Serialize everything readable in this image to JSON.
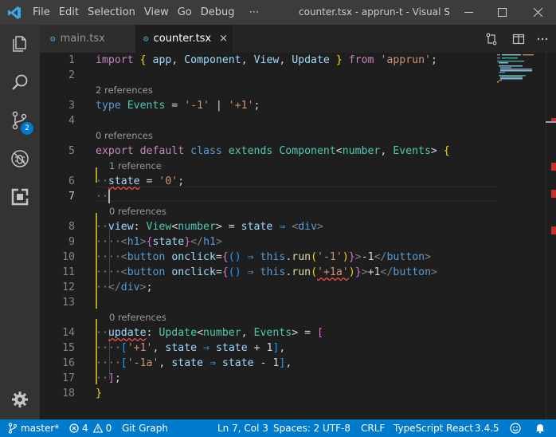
{
  "titlebar": {
    "app_icon": "vscode-logo-icon",
    "menu": [
      "File",
      "Edit",
      "Selection",
      "View",
      "Go",
      "Debug"
    ],
    "more": "⋯",
    "window_title": "counter.tsx - apprun-t - Visual St..."
  },
  "activitybar": {
    "items": [
      "explorer-icon",
      "search-icon",
      "source-control-icon",
      "debug-icon",
      "extensions-icon"
    ],
    "scm_badge": "2",
    "settings": "gear-icon"
  },
  "tabs": [
    {
      "label": "main.tsx",
      "icon": "TS",
      "active": false
    },
    {
      "label": "counter.tsx",
      "icon": "TS",
      "active": true,
      "close": "×"
    }
  ],
  "editor_actions": [
    "open-changes-icon",
    "split-editor-icon",
    "more-actions-icon"
  ],
  "editor": {
    "current_line": 7,
    "code_lens": {
      "l3": "2 references",
      "l5": "0 references",
      "l6": "1 reference",
      "l8": "0 references",
      "l14": "0 references"
    },
    "line_numbers": [
      "1",
      "2",
      "3",
      "4",
      "5",
      "6",
      "7",
      "8",
      "9",
      "10",
      "11",
      "12",
      "13",
      "14",
      "15",
      "16",
      "17",
      "18"
    ]
  },
  "statusbar": {
    "branch": "master*",
    "errors": "4",
    "warnings": "0",
    "git_graph": "Git Graph",
    "position": "Ln 7, Col 3",
    "spaces": "Spaces: 2",
    "encoding": "UTF-8",
    "eol": "CRLF",
    "language": "TypeScript React",
    "version": "3.4.5",
    "feedback_icon": "smiley-icon",
    "notifications_icon": "bell-icon"
  },
  "colors": {
    "accent": "#007acc",
    "titlebar": "#3c3c3c",
    "activitybar": "#333333",
    "editor": "#1e1e1e",
    "error": "#f14c4c"
  }
}
